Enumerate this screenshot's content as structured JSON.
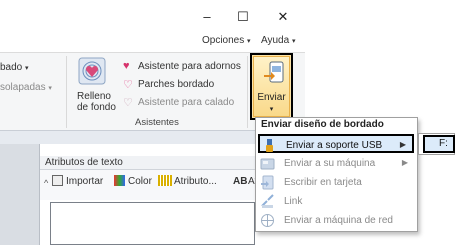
{
  "window": {
    "minimize": "–",
    "maximize": "☐",
    "close": "✕"
  },
  "menu": {
    "opciones": "Opciones",
    "ayuda": "Ayuda"
  },
  "ribbon": {
    "bado": "bado",
    "solapadas": "solapadas",
    "relleno_line1": "Relleno",
    "relleno_line2": "de fondo",
    "asistente_adornos": "Asistente para adornos",
    "parches_bordado": "Parches bordado",
    "asistente_calado": "Asistente para calado",
    "group_asistentes": "Asistentes",
    "enviar": "Enviar"
  },
  "panel": {
    "title": "Atributos de texto",
    "importar": "Importar",
    "color": "Color",
    "atributo": "Atributo...",
    "ab": "AB",
    "at": "At"
  },
  "dropdown": {
    "title": "Enviar diseño de bordado",
    "items": [
      {
        "label": "Enviar a soporte USB",
        "enabled": true,
        "submenu": true
      },
      {
        "label": "Enviar a su máquina",
        "enabled": false,
        "submenu": true
      },
      {
        "label": "Escribir en tarjeta",
        "enabled": false,
        "submenu": false
      },
      {
        "label": "Link",
        "enabled": false,
        "submenu": false
      },
      {
        "label": "Enviar a máquina de red",
        "enabled": false,
        "submenu": false
      }
    ]
  },
  "submenu": {
    "drive": "F:"
  }
}
